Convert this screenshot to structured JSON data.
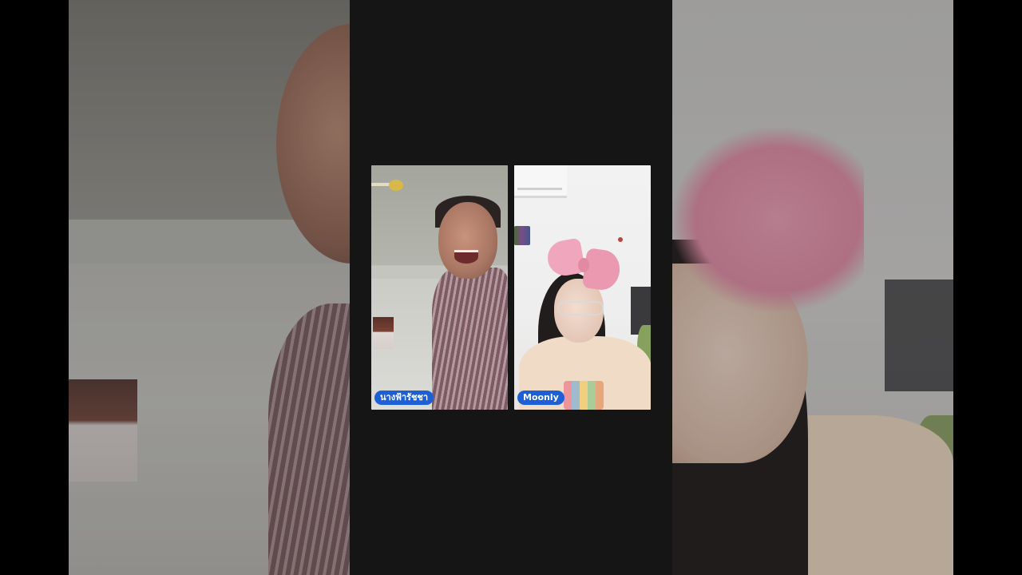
{
  "participants": [
    {
      "name": "นางฟ้ารัชชา",
      "badge_color": "#1f5fd6"
    },
    {
      "name": "Moonly",
      "badge_color": "#1f5fd6"
    }
  ]
}
